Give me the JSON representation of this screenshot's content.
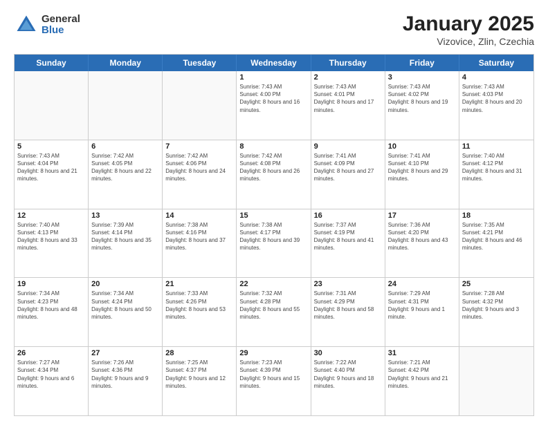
{
  "header": {
    "logo": {
      "general": "General",
      "blue": "Blue"
    },
    "title": "January 2025",
    "subtitle": "Vizovice, Zlin, Czechia"
  },
  "calendar": {
    "weekdays": [
      "Sunday",
      "Monday",
      "Tuesday",
      "Wednesday",
      "Thursday",
      "Friday",
      "Saturday"
    ],
    "weeks": [
      [
        {
          "day": "",
          "empty": true
        },
        {
          "day": "",
          "empty": true
        },
        {
          "day": "",
          "empty": true
        },
        {
          "day": "1",
          "sunrise": "7:43 AM",
          "sunset": "4:00 PM",
          "daylight": "8 hours and 16 minutes."
        },
        {
          "day": "2",
          "sunrise": "7:43 AM",
          "sunset": "4:01 PM",
          "daylight": "8 hours and 17 minutes."
        },
        {
          "day": "3",
          "sunrise": "7:43 AM",
          "sunset": "4:02 PM",
          "daylight": "8 hours and 19 minutes."
        },
        {
          "day": "4",
          "sunrise": "7:43 AM",
          "sunset": "4:03 PM",
          "daylight": "8 hours and 20 minutes."
        }
      ],
      [
        {
          "day": "5",
          "sunrise": "7:43 AM",
          "sunset": "4:04 PM",
          "daylight": "8 hours and 21 minutes."
        },
        {
          "day": "6",
          "sunrise": "7:42 AM",
          "sunset": "4:05 PM",
          "daylight": "8 hours and 22 minutes."
        },
        {
          "day": "7",
          "sunrise": "7:42 AM",
          "sunset": "4:06 PM",
          "daylight": "8 hours and 24 minutes."
        },
        {
          "day": "8",
          "sunrise": "7:42 AM",
          "sunset": "4:08 PM",
          "daylight": "8 hours and 26 minutes."
        },
        {
          "day": "9",
          "sunrise": "7:41 AM",
          "sunset": "4:09 PM",
          "daylight": "8 hours and 27 minutes."
        },
        {
          "day": "10",
          "sunrise": "7:41 AM",
          "sunset": "4:10 PM",
          "daylight": "8 hours and 29 minutes."
        },
        {
          "day": "11",
          "sunrise": "7:40 AM",
          "sunset": "4:12 PM",
          "daylight": "8 hours and 31 minutes."
        }
      ],
      [
        {
          "day": "12",
          "sunrise": "7:40 AM",
          "sunset": "4:13 PM",
          "daylight": "8 hours and 33 minutes."
        },
        {
          "day": "13",
          "sunrise": "7:39 AM",
          "sunset": "4:14 PM",
          "daylight": "8 hours and 35 minutes."
        },
        {
          "day": "14",
          "sunrise": "7:38 AM",
          "sunset": "4:16 PM",
          "daylight": "8 hours and 37 minutes."
        },
        {
          "day": "15",
          "sunrise": "7:38 AM",
          "sunset": "4:17 PM",
          "daylight": "8 hours and 39 minutes."
        },
        {
          "day": "16",
          "sunrise": "7:37 AM",
          "sunset": "4:19 PM",
          "daylight": "8 hours and 41 minutes."
        },
        {
          "day": "17",
          "sunrise": "7:36 AM",
          "sunset": "4:20 PM",
          "daylight": "8 hours and 43 minutes."
        },
        {
          "day": "18",
          "sunrise": "7:35 AM",
          "sunset": "4:21 PM",
          "daylight": "8 hours and 46 minutes."
        }
      ],
      [
        {
          "day": "19",
          "sunrise": "7:34 AM",
          "sunset": "4:23 PM",
          "daylight": "8 hours and 48 minutes."
        },
        {
          "day": "20",
          "sunrise": "7:34 AM",
          "sunset": "4:24 PM",
          "daylight": "8 hours and 50 minutes."
        },
        {
          "day": "21",
          "sunrise": "7:33 AM",
          "sunset": "4:26 PM",
          "daylight": "8 hours and 53 minutes."
        },
        {
          "day": "22",
          "sunrise": "7:32 AM",
          "sunset": "4:28 PM",
          "daylight": "8 hours and 55 minutes."
        },
        {
          "day": "23",
          "sunrise": "7:31 AM",
          "sunset": "4:29 PM",
          "daylight": "8 hours and 58 minutes."
        },
        {
          "day": "24",
          "sunrise": "7:29 AM",
          "sunset": "4:31 PM",
          "daylight": "9 hours and 1 minute."
        },
        {
          "day": "25",
          "sunrise": "7:28 AM",
          "sunset": "4:32 PM",
          "daylight": "9 hours and 3 minutes."
        }
      ],
      [
        {
          "day": "26",
          "sunrise": "7:27 AM",
          "sunset": "4:34 PM",
          "daylight": "9 hours and 6 minutes."
        },
        {
          "day": "27",
          "sunrise": "7:26 AM",
          "sunset": "4:36 PM",
          "daylight": "9 hours and 9 minutes."
        },
        {
          "day": "28",
          "sunrise": "7:25 AM",
          "sunset": "4:37 PM",
          "daylight": "9 hours and 12 minutes."
        },
        {
          "day": "29",
          "sunrise": "7:23 AM",
          "sunset": "4:39 PM",
          "daylight": "9 hours and 15 minutes."
        },
        {
          "day": "30",
          "sunrise": "7:22 AM",
          "sunset": "4:40 PM",
          "daylight": "9 hours and 18 minutes."
        },
        {
          "day": "31",
          "sunrise": "7:21 AM",
          "sunset": "4:42 PM",
          "daylight": "9 hours and 21 minutes."
        },
        {
          "day": "",
          "empty": true
        }
      ]
    ]
  }
}
